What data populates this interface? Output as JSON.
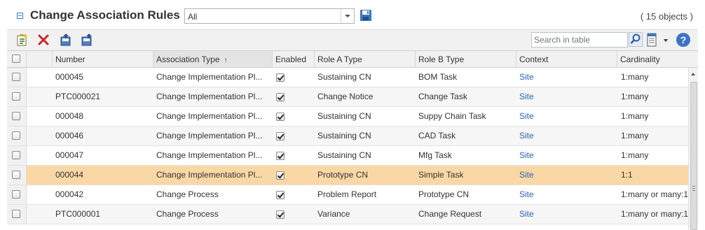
{
  "header": {
    "title": "Change Association Rules",
    "view_select": "All",
    "object_count": "( 15 objects )"
  },
  "toolbar": {
    "buttons": [
      "new-rule-icon",
      "delete-icon",
      "export-icon",
      "import-icon"
    ],
    "search_placeholder": "Search in table"
  },
  "table": {
    "columns": [
      "Number",
      "Association Type",
      "Enabled",
      "Role A Type",
      "Role B Type",
      "Context",
      "Cardinality"
    ],
    "sort_indicator": "↑",
    "rows": [
      {
        "number": "000045",
        "association_type": "Change Implementation Pl...",
        "enabled": true,
        "role_a": "Sustaining CN",
        "role_b": "BOM Task",
        "context": "Site",
        "cardinality": "1:many"
      },
      {
        "number": "PTC000021",
        "association_type": "Change Implementation Pl...",
        "enabled": true,
        "role_a": "Change Notice",
        "role_b": "Change Task",
        "context": "Site",
        "cardinality": "1:many"
      },
      {
        "number": "000048",
        "association_type": "Change Implementation Pl...",
        "enabled": true,
        "role_a": "Sustaining CN",
        "role_b": "Suppy Chain Task",
        "context": "Site",
        "cardinality": "1:many"
      },
      {
        "number": "000046",
        "association_type": "Change Implementation Pl...",
        "enabled": true,
        "role_a": "Sustaining CN",
        "role_b": "CAD Task",
        "context": "Site",
        "cardinality": "1:many"
      },
      {
        "number": "000047",
        "association_type": "Change Implementation Pl...",
        "enabled": true,
        "role_a": "Sustaining CN",
        "role_b": "Mfg Task",
        "context": "Site",
        "cardinality": "1:many"
      },
      {
        "number": "000044",
        "association_type": "Change Implementation Pl...",
        "enabled": true,
        "role_a": "Prototype CN",
        "role_b": "Simple Task",
        "context": "Site",
        "cardinality": "1:1"
      },
      {
        "number": "000042",
        "association_type": "Change Process",
        "enabled": true,
        "role_a": "Problem Report",
        "role_b": "Prototype CN",
        "context": "Site",
        "cardinality": "1:many or many:1"
      },
      {
        "number": "PTC000001",
        "association_type": "Change Process",
        "enabled": true,
        "role_a": "Variance",
        "role_b": "Change Request",
        "context": "Site",
        "cardinality": "1:many or many:1"
      }
    ]
  },
  "colors": {
    "highlight_row": "#fad8a6",
    "link": "#2a64b2",
    "accent": "#3a78c3"
  }
}
